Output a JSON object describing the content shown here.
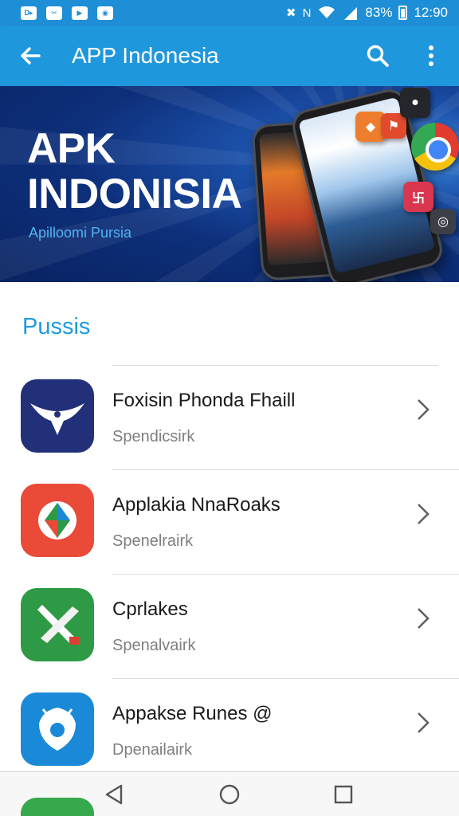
{
  "status_bar": {
    "battery": "83%",
    "time": "12:90",
    "notification_icons": [
      "d-icon",
      "scissors-icon",
      "play-store-icon",
      "camera-icon"
    ],
    "system_icons": [
      "mute-icon",
      "n-icon",
      "wifi-icon",
      "signal-icon",
      "battery-icon"
    ]
  },
  "app_bar": {
    "title": "APP Indonesia",
    "back_icon": "arrow-left-icon",
    "search_icon": "search-icon",
    "more_icon": "more-vertical-icon",
    "color": "#1f97dc"
  },
  "banner": {
    "heading_line1": "APK",
    "heading_line2": "INDONISIA",
    "subtitle": "Apilloomi Pursia",
    "background": "#0d2f7a"
  },
  "section": {
    "title": "Pussis",
    "title_color": "#1e9be0"
  },
  "apps": [
    {
      "title": "Foxisin Phonda Fhaill",
      "subtitle": "Spendicsirk",
      "icon": "bird-wing-icon",
      "icon_color": "#22307a"
    },
    {
      "title": "Applakia NnaRoaks",
      "subtitle": "Spenelrairk",
      "icon": "map-pin-icon",
      "icon_color": "#ea4a38"
    },
    {
      "title": "Cprlakes",
      "subtitle": "Spenalvairk",
      "icon": "crossed-tools-icon",
      "icon_color": "#2f9a46"
    },
    {
      "title": "Appakse Runes @",
      "subtitle": "Dpenailairk",
      "icon": "android-shield-icon",
      "icon_color": "#1a8ad8"
    }
  ],
  "nav_bar": {
    "back_icon": "nav-back-icon",
    "home_icon": "nav-home-icon",
    "recents_icon": "nav-recents-icon"
  }
}
